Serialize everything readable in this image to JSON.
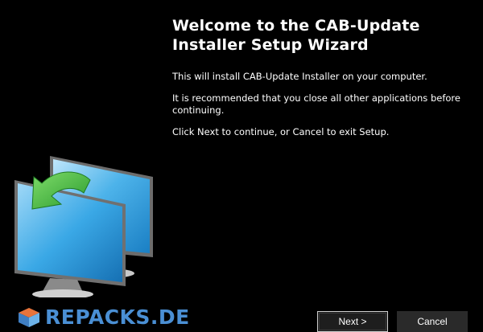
{
  "wizard": {
    "title": "Welcome to the CAB-Update Installer Setup Wizard",
    "paragraphs": [
      "This will install CAB-Update Installer on your computer.",
      "It is recommended that you close all other applications before continuing.",
      "Click Next to continue, or Cancel to exit Setup."
    ]
  },
  "branding": {
    "logo_text": "REPACKS.DE",
    "logo_icon": "cube-logo-icon",
    "logo_color": "#4a8fd4"
  },
  "sidebar": {
    "image_icon": "monitors-update-icon",
    "monitor_screen_color": "#3aa8e6",
    "arrow_color": "#3cb43c"
  },
  "buttons": {
    "next_label": "Next >",
    "cancel_label": "Cancel"
  }
}
